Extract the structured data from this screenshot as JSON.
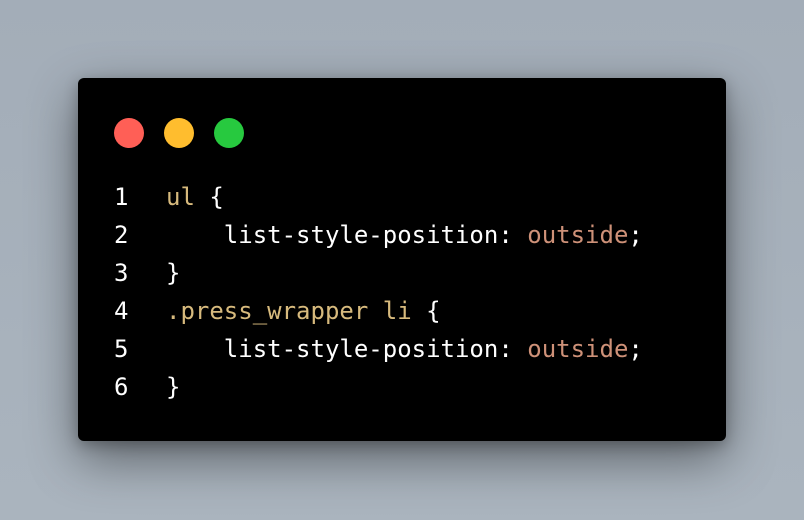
{
  "window": {
    "controls": [
      {
        "name": "close",
        "color": "#ff5f56"
      },
      {
        "name": "minimize",
        "color": "#ffbd2e"
      },
      {
        "name": "maximize",
        "color": "#27c93f"
      }
    ]
  },
  "code": {
    "lines": [
      {
        "number": "1",
        "tokens": [
          {
            "text": "ul",
            "kind": "selector"
          },
          {
            "text": " {",
            "kind": "plain"
          }
        ]
      },
      {
        "number": "2",
        "tokens": [
          {
            "text": "    list-style-position",
            "kind": "prop"
          },
          {
            "text": ": ",
            "kind": "plain"
          },
          {
            "text": "outside",
            "kind": "value"
          },
          {
            "text": ";",
            "kind": "plain"
          }
        ]
      },
      {
        "number": "3",
        "tokens": [
          {
            "text": "}",
            "kind": "plain"
          }
        ]
      },
      {
        "number": "4",
        "tokens": [
          {
            "text": ".press_wrapper li",
            "kind": "selector"
          },
          {
            "text": " {",
            "kind": "plain"
          }
        ]
      },
      {
        "number": "5",
        "tokens": [
          {
            "text": "    list-style-position",
            "kind": "prop"
          },
          {
            "text": ": ",
            "kind": "plain"
          },
          {
            "text": "outside",
            "kind": "value"
          },
          {
            "text": ";",
            "kind": "plain"
          }
        ]
      },
      {
        "number": "6",
        "tokens": [
          {
            "text": "}",
            "kind": "plain"
          }
        ]
      }
    ]
  }
}
